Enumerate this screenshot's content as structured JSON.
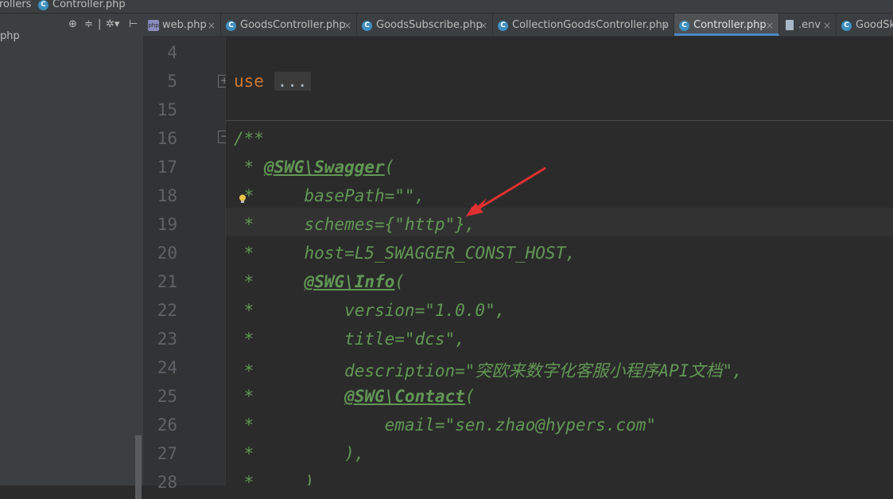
{
  "breadcrumb": {
    "folder": "rollers",
    "file": "Controller.php",
    "file_icon": "C"
  },
  "sidebar": {
    "item": "php"
  },
  "tabs": [
    {
      "label": "web.php",
      "icon": "php-file",
      "close": "×"
    },
    {
      "label": "GoodsController.php",
      "icon": "C",
      "close": "×"
    },
    {
      "label": "GoodsSubscribe.php",
      "icon": "C",
      "close": "×"
    },
    {
      "label": "CollectionGoodsController.php",
      "icon": "C",
      "close": "×"
    },
    {
      "label": "Controller.php",
      "icon": "C",
      "close": "×",
      "active": true
    },
    {
      "label": ".env",
      "icon": "file",
      "close": "×"
    },
    {
      "label": "GoodSku",
      "icon": "C",
      "close": ""
    }
  ],
  "editor": {
    "line_numbers": [
      "4",
      "5",
      "15",
      "16",
      "17",
      "18",
      "19",
      "20",
      "21",
      "22",
      "23",
      "24",
      "25",
      "26",
      "27",
      "28"
    ],
    "lines": {
      "l5_kw": "use",
      "l5_fold": "...",
      "l16": "/**",
      "l17_pre": " * ",
      "l17_tag": "@SWG\\Swagger",
      "l17_post": "(",
      "l18": " *     basePath=\"\",",
      "l19": " *     schemes={\"http\"},",
      "l20": " *     host=L5_SWAGGER_CONST_HOST,",
      "l21_pre": " *     ",
      "l21_tag": "@SWG\\Info",
      "l21_post": "(",
      "l22": " *         version=\"1.0.0\",",
      "l23": " *         title=\"dcs\",",
      "l24": " *         description=\"突欧来数字化客服小程序API文档\",",
      "l25_pre": " *         ",
      "l25_tag": "@SWG\\Contact",
      "l25_post": "(",
      "l26": " *             email=\"sen.zhao@hypers.com\"",
      "l27": " *         ),",
      "l28": " *     )"
    }
  },
  "colors": {
    "comment": "#629755",
    "keyword": "#cc7832",
    "arrow": "#e03030",
    "accent": "#4a88c7"
  }
}
